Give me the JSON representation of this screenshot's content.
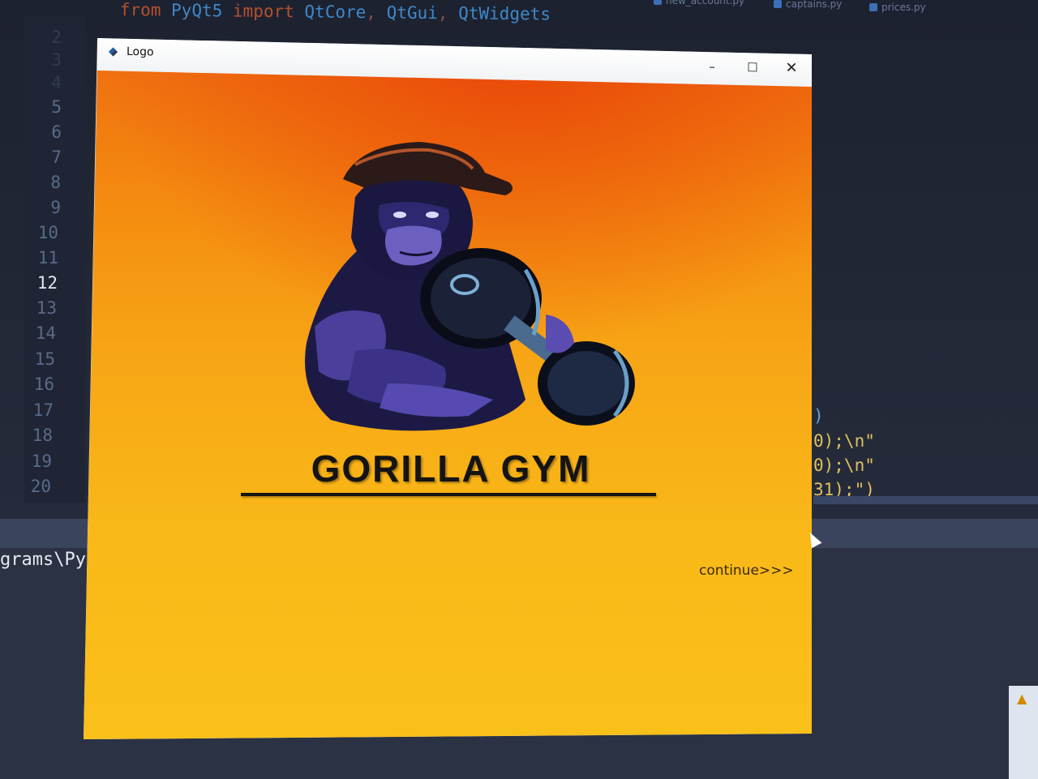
{
  "editor": {
    "import_line": {
      "keyword_from": "from",
      "module": "PyQt5",
      "keyword_import": "import",
      "items": [
        "QtCore",
        "QtGui",
        "QtWidgets"
      ]
    },
    "tabs": [
      "new_account.py",
      "captains.py",
      "prices.py"
    ],
    "line_numbers": [
      "2",
      "3",
      "4",
      "5",
      "6",
      "7",
      "8",
      "9",
      "10",
      "11",
      "12",
      "13",
      "14",
      "15",
      "16",
      "17",
      "18",
      "19",
      "20"
    ],
    "active_line": "12",
    "code_fragments": [
      ")",
      "0);\\n\"",
      "0);\\n\"",
      "31);\")"
    ]
  },
  "terminal": {
    "path_fragment": "grams\\Py"
  },
  "window": {
    "title": "Logo",
    "controls": {
      "minimize": "–",
      "maximize": "☐",
      "close": "✕"
    },
    "brand_title": "GORILLA GYM",
    "continue_label": "continue>>>",
    "colors": {
      "bg_top": "#ee6a10",
      "bg_bottom": "#fac01a",
      "text": "#141414"
    }
  }
}
